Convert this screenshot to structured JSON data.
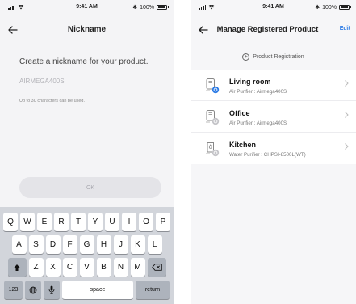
{
  "status_bar": {
    "time": "9:41 AM",
    "battery": "100%"
  },
  "nickname_screen": {
    "title": "Nickname",
    "prompt": "Create a nickname for your product.",
    "input_placeholder": "AIRMEGA400S",
    "hint": "Up to 30 characters can be used.",
    "ok_label": "OK"
  },
  "keyboard": {
    "row1": [
      "Q",
      "W",
      "E",
      "R",
      "T",
      "Y",
      "U",
      "I",
      "O",
      "P"
    ],
    "row2": [
      "A",
      "S",
      "D",
      "F",
      "G",
      "H",
      "J",
      "K",
      "L"
    ],
    "row3": [
      "Z",
      "X",
      "C",
      "V",
      "B",
      "N",
      "M"
    ],
    "numbers_label": "123",
    "space_label": "space",
    "return_label": "return"
  },
  "manage_screen": {
    "title": "Manage Registered Product",
    "edit_label": "Edit",
    "registration_label": "Product Registration",
    "products": [
      {
        "name": "Living room",
        "type": "Air Purifier : Airmega400S",
        "icon": "air-purifier-icon",
        "status_color": "#2c7be5"
      },
      {
        "name": "Office",
        "type": "Air Purifier : Airmega400S",
        "icon": "air-purifier-icon",
        "status_color": "#c4c4c8"
      },
      {
        "name": "Kitchen",
        "type": "Water Purifier : CHPSI-8500L(WT)",
        "icon": "water-purifier-icon",
        "status_color": "#c4c4c8"
      }
    ]
  },
  "colors": {
    "accent": "#2c7be5",
    "keyboard_bg": "#d2d5db",
    "key_fn": "#adb3bc"
  }
}
